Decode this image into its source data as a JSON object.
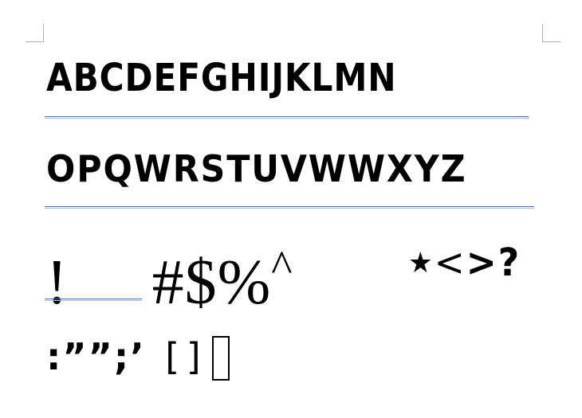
{
  "rows": {
    "uppercase_1": "ABCDEFGHIJKLMN",
    "uppercase_2": "OPQWRSTUVWWXYZ",
    "symbols_left_1": "!",
    "symbols_left_2": "#$%",
    "symbols_caret": "^",
    "symbols_right_star": "★",
    "symbols_right_lt": "<",
    "symbols_right_rest": ">?",
    "punct": ":””;’",
    "brackets": "[]"
  },
  "colors": {
    "rule_dark": "#3f6fc0",
    "rule_light": "#a9bde6",
    "corner_mark": "#b0b0b0"
  }
}
